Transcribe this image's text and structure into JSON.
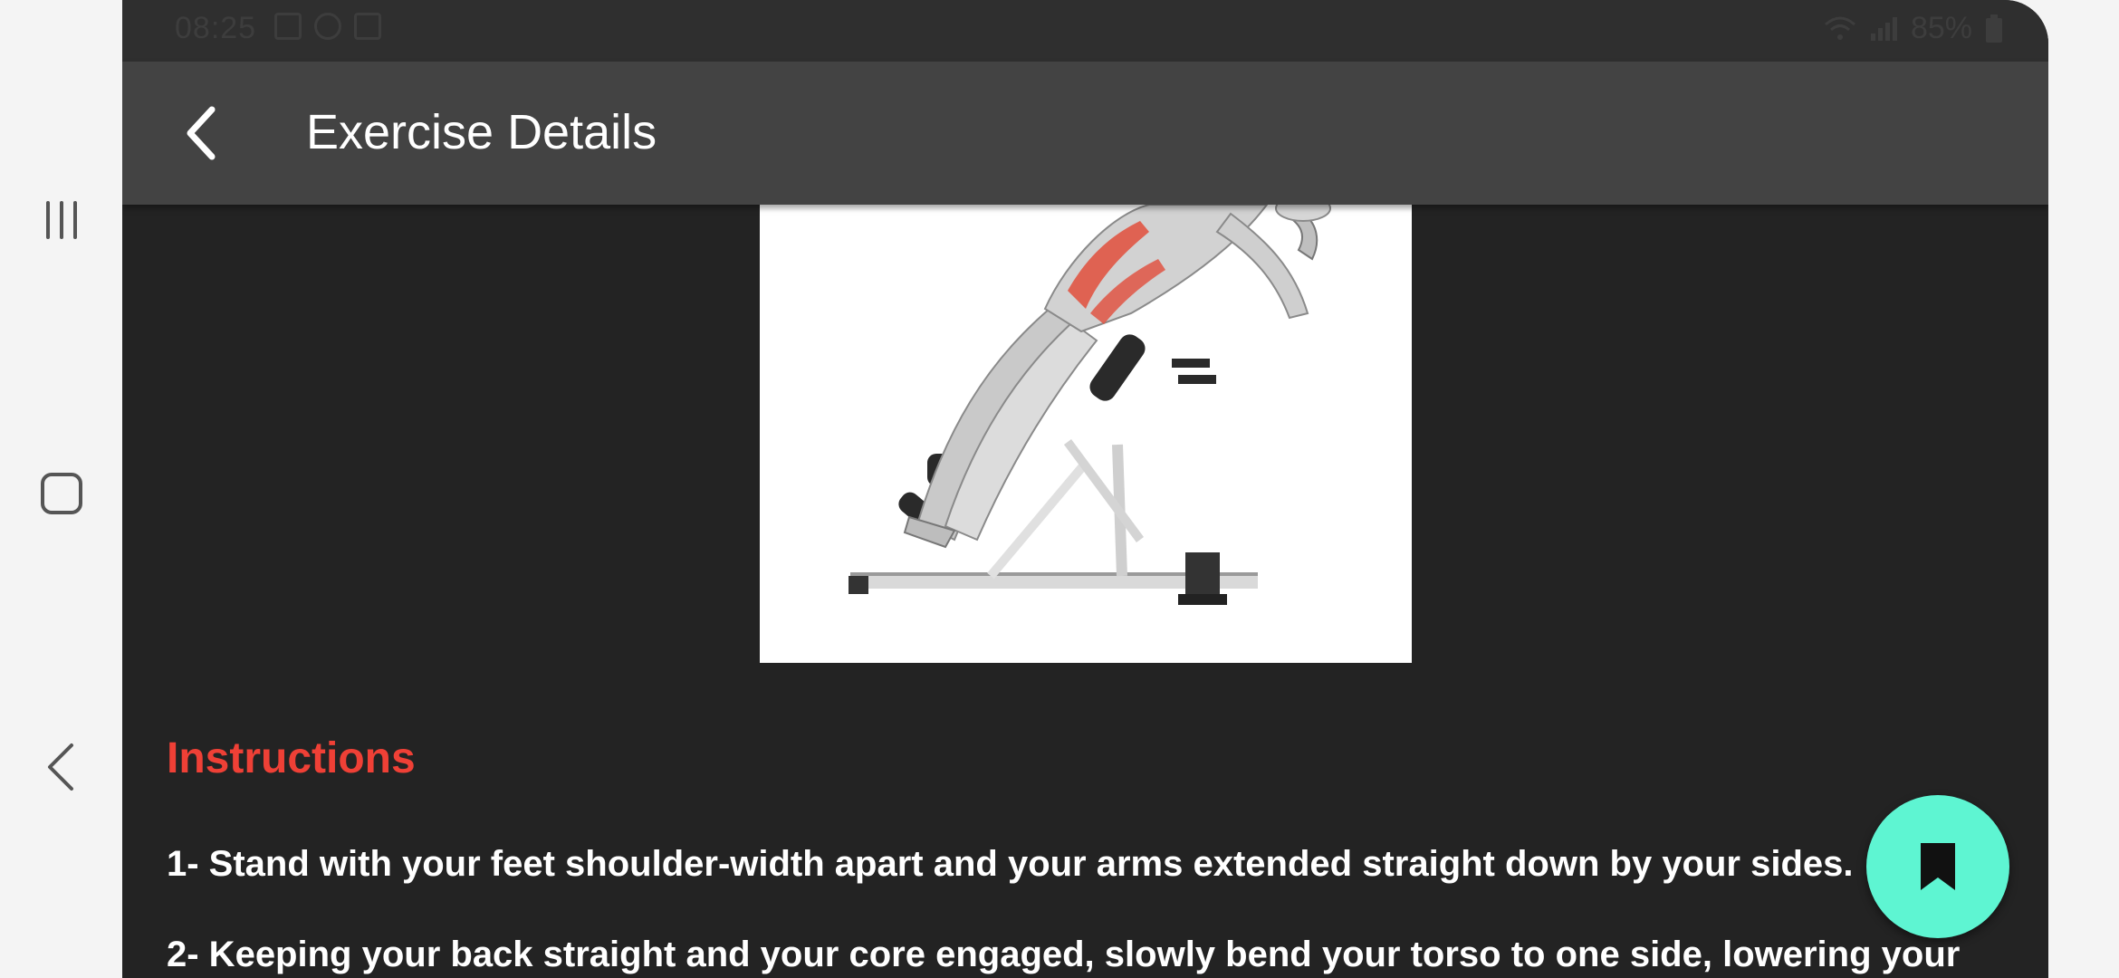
{
  "status_bar": {
    "time": "08:25",
    "battery": "85%"
  },
  "app_bar": {
    "title": "Exercise Details",
    "back_icon": "chevron-left-icon"
  },
  "exercise": {
    "image_icon": "exercise-illustration",
    "accent_muscle_color": "#e05544"
  },
  "instructions": {
    "heading": "Instructions",
    "steps": [
      "1- Stand with your feet shoulder-width apart and your arms extended straight down by your sides.",
      "2- Keeping your back straight and your core engaged, slowly bend your torso to one side, lowering your"
    ]
  },
  "fab": {
    "icon": "bookmark-icon",
    "color": "#5ef5d2"
  },
  "system_nav": {
    "recents_icon": "recents-icon",
    "home_icon": "home-icon",
    "back_icon": "back-icon"
  },
  "colors": {
    "background": "#232323",
    "app_bar": "#434343",
    "heading_accent": "#ef4036"
  }
}
